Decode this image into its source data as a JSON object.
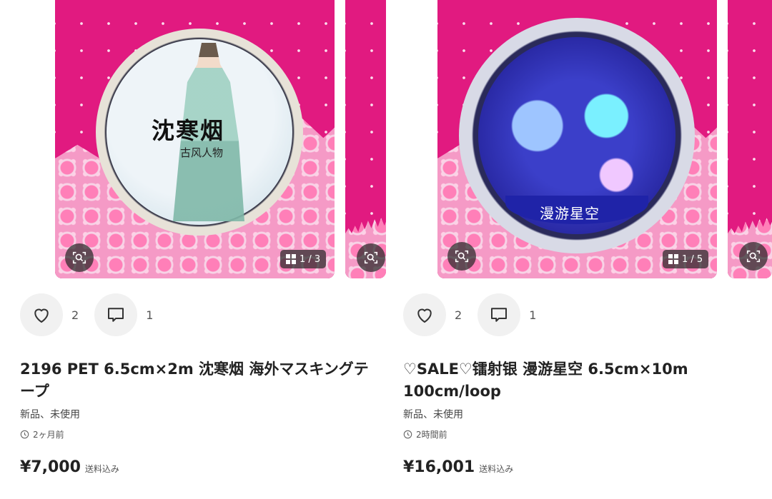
{
  "items": [
    {
      "tape_title": "沈寒烟",
      "tape_subtitle": "古风人物",
      "image_counter": "1 / 3",
      "likes": "2",
      "comments": "1",
      "title": "2196 PET 6.5cm×2m 沈寒烟 海外マスキングテープ",
      "condition": "新品、未使用",
      "posted": "2ヶ月前",
      "price": "¥7,000",
      "shipping": "送料込み"
    },
    {
      "tape_title": "漫游星空",
      "image_counter": "1 / 5",
      "likes": "2",
      "comments": "1",
      "title": "♡SALE♡镭射银 漫游星空 6.5cm×10m 100cm/loop",
      "condition": "新品、未使用",
      "posted": "2時間前",
      "price": "¥16,001",
      "shipping": "送料込み"
    }
  ],
  "icons": {
    "zoom": "image-search-icon",
    "counter": "gallery-grid-icon",
    "like": "heart-icon",
    "comment": "comment-icon",
    "time": "clock-icon"
  }
}
